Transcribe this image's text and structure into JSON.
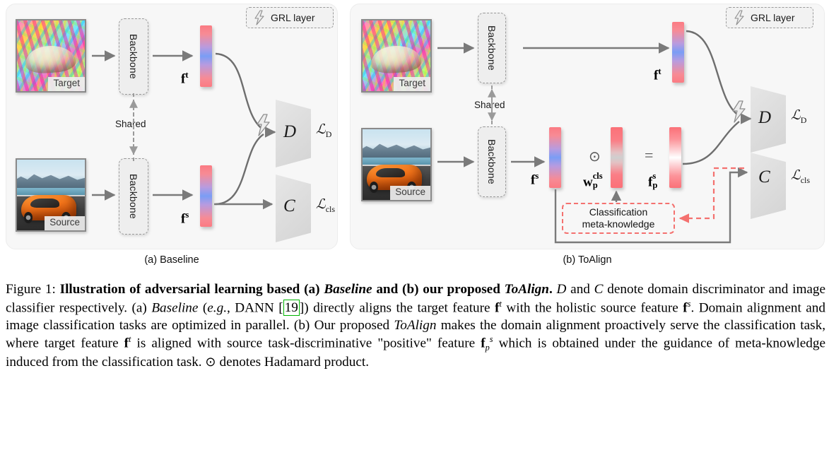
{
  "panels": [
    {
      "id": "a",
      "caption": "(a) Baseline",
      "target_image_label": "Target",
      "source_image_label": "Source",
      "backbone_label": "Backbone",
      "shared_label": "Shared",
      "grl_legend_label": "GRL layer",
      "features": [
        {
          "key": "ft",
          "base": "f",
          "sup": "t"
        },
        {
          "key": "fs",
          "base": "f",
          "sup": "s"
        }
      ],
      "discriminator_letter": "D",
      "classifier_letter": "C",
      "loss_d": "ℒ",
      "loss_d_sub": "D",
      "loss_cls": "ℒ",
      "loss_cls_sub": "cls"
    },
    {
      "id": "b",
      "caption": "(b) ToAlign",
      "target_image_label": "Target",
      "source_image_label": "Source",
      "backbone_label": "Backbone",
      "shared_label": "Shared",
      "grl_legend_label": "GRL layer",
      "features": [
        {
          "key": "ft",
          "base": "f",
          "sup": "t"
        },
        {
          "key": "fs",
          "base": "f",
          "sup": "s"
        },
        {
          "key": "wpcls",
          "base": "w",
          "sup": "cls",
          "sub": "p"
        },
        {
          "key": "fps",
          "base": "f",
          "sup": "s",
          "sub": "p"
        }
      ],
      "hadamard_symbol": "⊙",
      "equals_symbol": "=",
      "meta_box_line1": "Classification",
      "meta_box_line2": "meta-knowledge",
      "discriminator_letter": "D",
      "classifier_letter": "C",
      "loss_d": "ℒ",
      "loss_d_sub": "D",
      "loss_cls": "ℒ",
      "loss_cls_sub": "cls"
    }
  ],
  "caption": {
    "figure_number": "Figure 1:",
    "title_bold": "Illustration of adversarial learning based (a)",
    "baseline_italic_1": "Baseline",
    "title_bold_2": "and (b) our proposed",
    "toalign_italic_1": "ToAlign",
    "full_text": "Figure 1: Illustration of adversarial learning based (a) Baseline and (b) our proposed ToAlign. D and C denote domain discriminator and image classifier respectively. (a) Baseline (e.g., DANN [19]) directly aligns the target feature f^t with the holistic source feature f^s. Domain alignment and image classification tasks are optimized in parallel. (b) Our proposed ToAlign makes the domain alignment proactively serve the classification task, where target feature f^t is aligned with source task-discriminative \"positive\" feature f_p^s which is obtained under the guidance of meta-knowledge induced from the classification task. ⊙ denotes Hadamard product.",
    "citation": "19"
  },
  "colors": {
    "panel_bg": "#f7f7f7",
    "feature_red": "#fb7178",
    "feature_blue": "#7a9df5",
    "meta_red": "#f4716f",
    "wire_gray": "#6e6e6e",
    "trapezoid": "#dcdcdc",
    "citation_green": "#00b400"
  }
}
